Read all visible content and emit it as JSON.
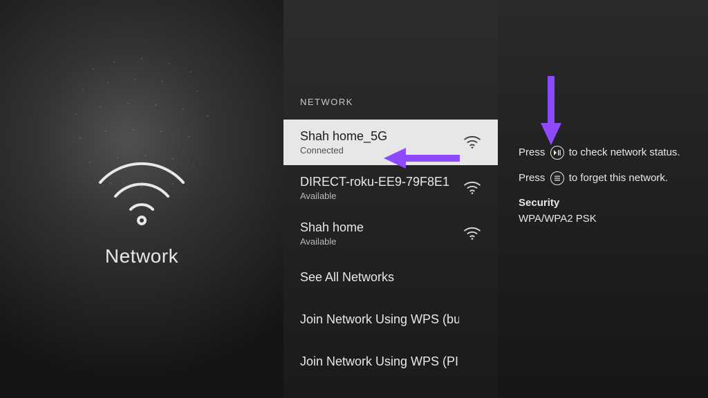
{
  "hero": {
    "title": "Network"
  },
  "list": {
    "header": "NETWORK",
    "networks": [
      {
        "name": "Shah home_5G",
        "status": "Connected",
        "selected": true
      },
      {
        "name": "DIRECT-roku-EE9-79F8E1",
        "status": "Available",
        "selected": false
      },
      {
        "name": "Shah home",
        "status": "Available",
        "selected": false
      }
    ],
    "actions": [
      {
        "label": "See All Networks"
      },
      {
        "label": "Join Network Using WPS (button)"
      },
      {
        "label": "Join Network Using WPS (PIN)"
      }
    ]
  },
  "info": {
    "line1_pre": "Press",
    "line1_post": "to check network status.",
    "line2_pre": "Press",
    "line2_post": "to forget this network.",
    "security_label": "Security",
    "security_value": "WPA/WPA2 PSK",
    "play_icon_label": "play-pause",
    "menu_icon_label": "menu"
  },
  "colors": {
    "accent_arrow": "#8d4aff"
  }
}
